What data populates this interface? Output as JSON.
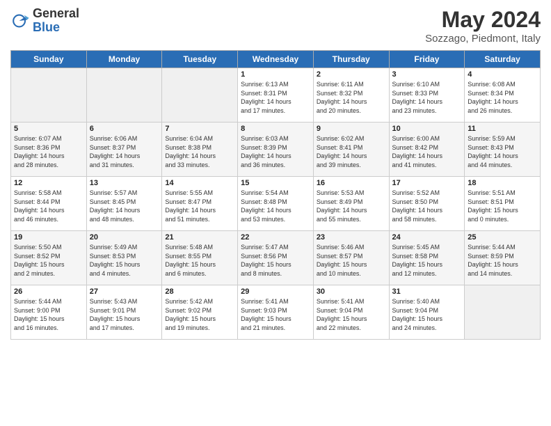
{
  "logo": {
    "general": "General",
    "blue": "Blue"
  },
  "title": "May 2024",
  "location": "Sozzago, Piedmont, Italy",
  "days_of_week": [
    "Sunday",
    "Monday",
    "Tuesday",
    "Wednesday",
    "Thursday",
    "Friday",
    "Saturday"
  ],
  "weeks": [
    [
      {
        "day": "",
        "info": ""
      },
      {
        "day": "",
        "info": ""
      },
      {
        "day": "",
        "info": ""
      },
      {
        "day": "1",
        "info": "Sunrise: 6:13 AM\nSunset: 8:31 PM\nDaylight: 14 hours\nand 17 minutes."
      },
      {
        "day": "2",
        "info": "Sunrise: 6:11 AM\nSunset: 8:32 PM\nDaylight: 14 hours\nand 20 minutes."
      },
      {
        "day": "3",
        "info": "Sunrise: 6:10 AM\nSunset: 8:33 PM\nDaylight: 14 hours\nand 23 minutes."
      },
      {
        "day": "4",
        "info": "Sunrise: 6:08 AM\nSunset: 8:34 PM\nDaylight: 14 hours\nand 26 minutes."
      }
    ],
    [
      {
        "day": "5",
        "info": "Sunrise: 6:07 AM\nSunset: 8:36 PM\nDaylight: 14 hours\nand 28 minutes."
      },
      {
        "day": "6",
        "info": "Sunrise: 6:06 AM\nSunset: 8:37 PM\nDaylight: 14 hours\nand 31 minutes."
      },
      {
        "day": "7",
        "info": "Sunrise: 6:04 AM\nSunset: 8:38 PM\nDaylight: 14 hours\nand 33 minutes."
      },
      {
        "day": "8",
        "info": "Sunrise: 6:03 AM\nSunset: 8:39 PM\nDaylight: 14 hours\nand 36 minutes."
      },
      {
        "day": "9",
        "info": "Sunrise: 6:02 AM\nSunset: 8:41 PM\nDaylight: 14 hours\nand 39 minutes."
      },
      {
        "day": "10",
        "info": "Sunrise: 6:00 AM\nSunset: 8:42 PM\nDaylight: 14 hours\nand 41 minutes."
      },
      {
        "day": "11",
        "info": "Sunrise: 5:59 AM\nSunset: 8:43 PM\nDaylight: 14 hours\nand 44 minutes."
      }
    ],
    [
      {
        "day": "12",
        "info": "Sunrise: 5:58 AM\nSunset: 8:44 PM\nDaylight: 14 hours\nand 46 minutes."
      },
      {
        "day": "13",
        "info": "Sunrise: 5:57 AM\nSunset: 8:45 PM\nDaylight: 14 hours\nand 48 minutes."
      },
      {
        "day": "14",
        "info": "Sunrise: 5:55 AM\nSunset: 8:47 PM\nDaylight: 14 hours\nand 51 minutes."
      },
      {
        "day": "15",
        "info": "Sunrise: 5:54 AM\nSunset: 8:48 PM\nDaylight: 14 hours\nand 53 minutes."
      },
      {
        "day": "16",
        "info": "Sunrise: 5:53 AM\nSunset: 8:49 PM\nDaylight: 14 hours\nand 55 minutes."
      },
      {
        "day": "17",
        "info": "Sunrise: 5:52 AM\nSunset: 8:50 PM\nDaylight: 14 hours\nand 58 minutes."
      },
      {
        "day": "18",
        "info": "Sunrise: 5:51 AM\nSunset: 8:51 PM\nDaylight: 15 hours\nand 0 minutes."
      }
    ],
    [
      {
        "day": "19",
        "info": "Sunrise: 5:50 AM\nSunset: 8:52 PM\nDaylight: 15 hours\nand 2 minutes."
      },
      {
        "day": "20",
        "info": "Sunrise: 5:49 AM\nSunset: 8:53 PM\nDaylight: 15 hours\nand 4 minutes."
      },
      {
        "day": "21",
        "info": "Sunrise: 5:48 AM\nSunset: 8:55 PM\nDaylight: 15 hours\nand 6 minutes."
      },
      {
        "day": "22",
        "info": "Sunrise: 5:47 AM\nSunset: 8:56 PM\nDaylight: 15 hours\nand 8 minutes."
      },
      {
        "day": "23",
        "info": "Sunrise: 5:46 AM\nSunset: 8:57 PM\nDaylight: 15 hours\nand 10 minutes."
      },
      {
        "day": "24",
        "info": "Sunrise: 5:45 AM\nSunset: 8:58 PM\nDaylight: 15 hours\nand 12 minutes."
      },
      {
        "day": "25",
        "info": "Sunrise: 5:44 AM\nSunset: 8:59 PM\nDaylight: 15 hours\nand 14 minutes."
      }
    ],
    [
      {
        "day": "26",
        "info": "Sunrise: 5:44 AM\nSunset: 9:00 PM\nDaylight: 15 hours\nand 16 minutes."
      },
      {
        "day": "27",
        "info": "Sunrise: 5:43 AM\nSunset: 9:01 PM\nDaylight: 15 hours\nand 17 minutes."
      },
      {
        "day": "28",
        "info": "Sunrise: 5:42 AM\nSunset: 9:02 PM\nDaylight: 15 hours\nand 19 minutes."
      },
      {
        "day": "29",
        "info": "Sunrise: 5:41 AM\nSunset: 9:03 PM\nDaylight: 15 hours\nand 21 minutes."
      },
      {
        "day": "30",
        "info": "Sunrise: 5:41 AM\nSunset: 9:04 PM\nDaylight: 15 hours\nand 22 minutes."
      },
      {
        "day": "31",
        "info": "Sunrise: 5:40 AM\nSunset: 9:04 PM\nDaylight: 15 hours\nand 24 minutes."
      },
      {
        "day": "",
        "info": ""
      }
    ]
  ]
}
